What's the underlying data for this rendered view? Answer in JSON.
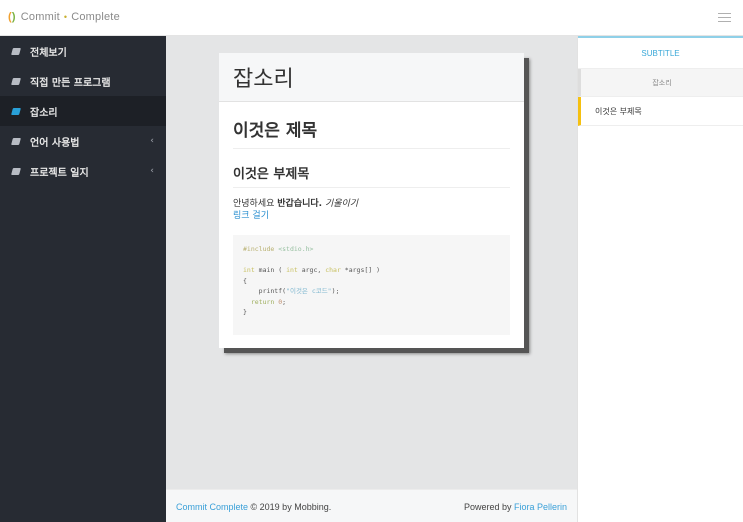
{
  "header": {
    "logo_glyph": "(",
    "logo_glyph2": ")",
    "brand_part1": "Commit",
    "brand_sep": "•",
    "brand_part2": "Complete"
  },
  "sidebar": {
    "items": [
      {
        "label": "전체보기",
        "icon": "book-icon",
        "active": false,
        "has_chevron": false
      },
      {
        "label": "직접 만든 프로그램",
        "icon": "book-icon",
        "active": false,
        "has_chevron": false
      },
      {
        "label": "잡소리",
        "icon": "book-icon",
        "active": true,
        "has_chevron": false
      },
      {
        "label": "언어 사용법",
        "icon": "book-icon",
        "active": false,
        "has_chevron": true
      },
      {
        "label": "프로젝트 일지",
        "icon": "book-icon",
        "active": false,
        "has_chevron": true
      }
    ],
    "chevron": "‹"
  },
  "card": {
    "title": "잡소리",
    "h2": "이것은 제목",
    "h3": "이것은 부제목",
    "para_normal": "안녕하세요 ",
    "para_bold": "반갑습니다.",
    "para_italic": "기울이기",
    "link": "링크 걸기",
    "code": {
      "line1_pre": "#include",
      "line1_inc": "<stdio.h>",
      "line2_a": "int",
      "line2_b": " main ( ",
      "line2_c": "int",
      "line2_d": " argc, ",
      "line2_e": "char",
      "line2_f": " *args[] )",
      "line3": "{",
      "line4_a": "    printf(",
      "line4_b": "\"이것은 c코드\"",
      "line4_c": ");",
      "line5_a": "  return",
      "line5_b": " 0",
      "line5_c": ";",
      "line6": "}"
    }
  },
  "footer": {
    "left_link": "Commit Complete",
    "left_text": " © 2019 by Mobbing.",
    "right_text": "Powered by ",
    "right_link": "Fiora Pellerin"
  },
  "toc": {
    "heading": "SUBTITLE",
    "title": "잡소리",
    "items": [
      "이것은 부제목"
    ]
  }
}
